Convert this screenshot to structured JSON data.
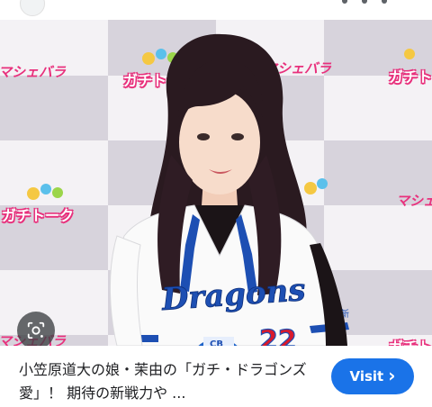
{
  "result_card": {
    "caption": "小笠原道大の娘・茉由の「ガチ・ドラゴンズ愛」！ 期待の新戦力や ...",
    "visit_label": "Visit",
    "visit_chevron": "›"
  },
  "photo": {
    "backdrop_logo_pink": "マシェバラ",
    "backdrop_logo_talk": "ガチトーク",
    "backdrop_logo_partial": "ガチト",
    "backdrop_logo_partial_pink": "マシェ",
    "jersey_wordmark": "Dragons",
    "jersey_number": "22",
    "jersey_sleeve": "中新",
    "mic_flag": "CB"
  },
  "icons": {
    "lens": "google-lens-icon",
    "chevron": "chevron-right-icon",
    "favicon": "site-favicon-icon"
  },
  "colors": {
    "visit_button": "#1a73e8",
    "backdrop_pink": "#e8307c",
    "backdrop_gray": "#d3d0d8",
    "jersey_blue": "#1d4fb3",
    "number_red": "#d8192c"
  }
}
